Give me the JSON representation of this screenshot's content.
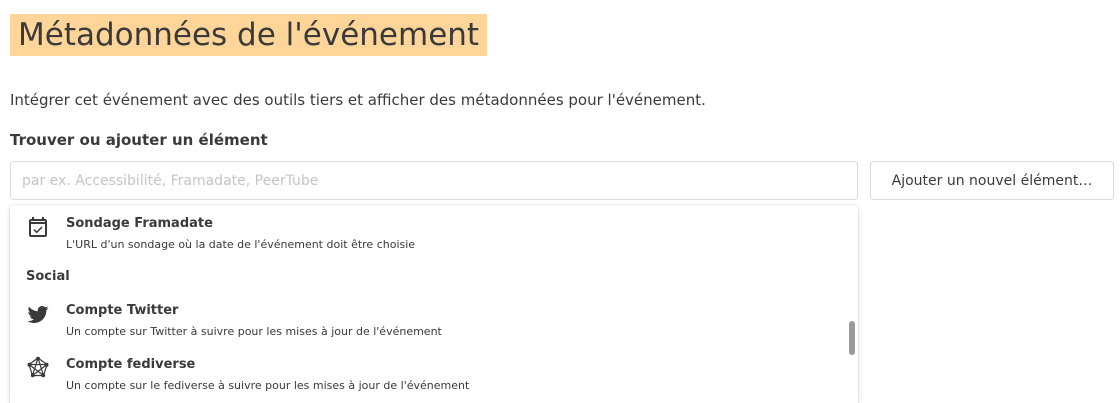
{
  "section": {
    "title": "Métadonnées de l'événement",
    "description": "Intégrer cet événement avec des outils tiers et afficher des métadonnées pour l'événement."
  },
  "search": {
    "label": "Trouver ou ajouter un élément",
    "placeholder": "par ex. Accessibilité, Framadate, PeerTube",
    "value": ""
  },
  "add_button": {
    "label": "Ajouter un nouvel élément…"
  },
  "dropdown": {
    "items_top": [
      {
        "icon": "calendar-check-icon",
        "title": "Sondage Framadate",
        "description": "L'URL d'un sondage où la date de l'événement doit être choisie"
      }
    ],
    "group": {
      "label": "Social"
    },
    "items_social": [
      {
        "icon": "twitter-icon",
        "title": "Compte Twitter",
        "description": "Un compte sur Twitter à suivre pour les mises à jour de l'événement"
      },
      {
        "icon": "fediverse-icon",
        "title": "Compte fediverse",
        "description": "Un compte sur le fediverse à suivre pour les mises à jour de l'événement"
      }
    ]
  },
  "colors": {
    "title_highlight": "#ffd599",
    "text": "#3a3a3a",
    "border": "#dbdbdb",
    "placeholder": "#c5c5c5",
    "scrollbar": "#9a9a9a"
  }
}
